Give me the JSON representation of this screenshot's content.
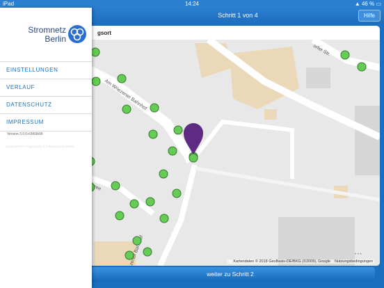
{
  "status_bar": {
    "carrier": "iPad",
    "time": "14:24",
    "battery": "46 %"
  },
  "nav": {
    "title": "Schritt 1 von 4",
    "help_label": "Hilfe"
  },
  "card": {
    "title_partial": "gsort"
  },
  "map": {
    "streets": [
      "Am Wriezener Bahnhof",
      "Karree",
      "zener Bahnhof",
      "orfer Str."
    ],
    "attribution": "Kartendaten © 2018 GeoBasis-DE/BKG (©2009), Google",
    "terms": "Nutzungsbedingungen",
    "colors": {
      "marker": "#5e2b82",
      "station": "#66cc55",
      "road": "#ffffff",
      "building": "#d9d9d9"
    }
  },
  "next_button": {
    "label": "weiter zu Schritt 2"
  },
  "drawer": {
    "logo": {
      "line1": "Stromnetz",
      "line2": "Berlin"
    },
    "menu": [
      {
        "label": "EINSTELLUNGEN"
      },
      {
        "label": "VERLAUF"
      },
      {
        "label": "DATENSCHUTZ"
      },
      {
        "label": "IMPRESSUM"
      }
    ],
    "version": "Version 3.0.0+0966b96",
    "legal": "Vorgesehenes Impressum & Zulassungshinweise"
  }
}
